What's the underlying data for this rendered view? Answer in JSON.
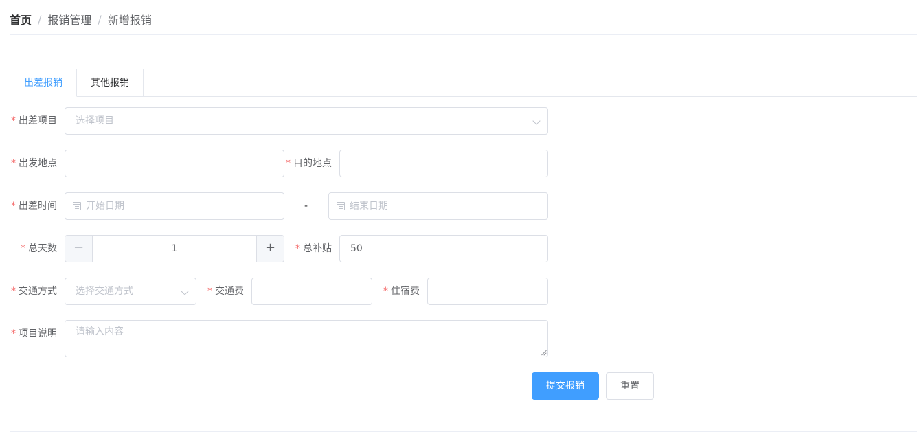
{
  "breadcrumb": {
    "home": "首页",
    "level1": "报销管理",
    "level2": "新增报销",
    "separator": "/"
  },
  "tabs": [
    {
      "label": "出差报销",
      "active": true
    },
    {
      "label": "其他报销",
      "active": false
    }
  ],
  "form": {
    "required_mark": "*",
    "project": {
      "label": "出差项目",
      "placeholder": "选择项目"
    },
    "departure": {
      "label": "出发地点",
      "value": ""
    },
    "destination": {
      "label": "目的地点",
      "value": ""
    },
    "trip_time": {
      "label": "出差时间",
      "start_placeholder": "开始日期",
      "end_placeholder": "结束日期",
      "separator": "-"
    },
    "total_days": {
      "label": "总天数",
      "value": "1",
      "minus": "−",
      "plus": "+"
    },
    "allowance": {
      "label": "总补贴",
      "value": "50"
    },
    "transport_mode": {
      "label": "交通方式",
      "placeholder": "选择交通方式"
    },
    "transport_fee": {
      "label": "交通费",
      "value": ""
    },
    "lodging_fee": {
      "label": "住宿费",
      "value": ""
    },
    "description": {
      "label": "项目说明",
      "placeholder": "请输入内容"
    }
  },
  "actions": {
    "submit": "提交报销",
    "reset": "重置"
  },
  "colors": {
    "primary": "#409eff",
    "required": "#f56c6c",
    "border": "#dcdfe6",
    "placeholder": "#c0c4cc"
  },
  "icons": {
    "select_arrow": "chevron-down-icon",
    "date": "calendar-icon"
  }
}
